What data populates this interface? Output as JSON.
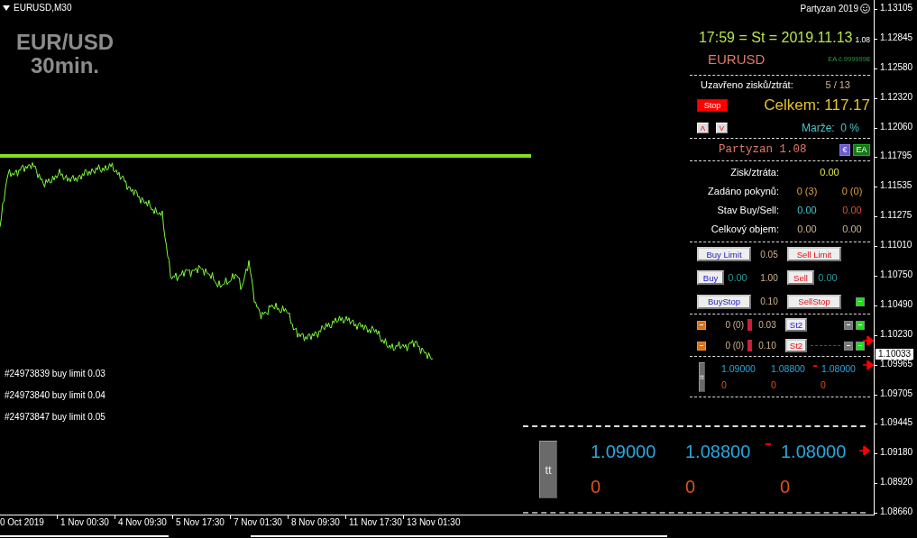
{
  "chart": {
    "title": "EURUSD,M30",
    "watermark": [
      "EUR/USD",
      "30min."
    ],
    "orders": [
      "#24973839 buy limit 0.03",
      "#24973840 buy limit 0.04",
      "#24973847 buy limit 0.05"
    ]
  },
  "price_axis": {
    "labels": [
      "1.13105",
      "1.12845",
      "1.12580",
      "1.12320",
      "1.12060",
      "1.11795",
      "1.11535",
      "1.11275",
      "1.11010",
      "1.10750",
      "1.10490",
      "1.10230",
      "1.09965",
      "1.09705",
      "1.09445",
      "1.09180",
      "1.08920",
      "1.08660"
    ],
    "current_price": "1.10033"
  },
  "time_axis": {
    "labels": [
      "0 Oct 2019",
      "1 Nov 00:30",
      "4 Nov 09:30",
      "5 Nov 17:30",
      "7 Nov 01:30",
      "8 Nov 09:30",
      "11 Nov 17:30",
      "13 Nov 01:30"
    ]
  },
  "panel": {
    "brand": "Partyzan 2019",
    "clock": "17:59 = St = 2019.11.13",
    "clock_version": "1.08",
    "symbol": "EURUSD",
    "ea_number": "EA č.9999998",
    "closed_label": "Uzavřeno zisků/ztrát:",
    "closed_value": "5 / 13",
    "stop_button": "Stop",
    "total": "Celkem: 117.17",
    "up_button": "Λ",
    "down_button": "V",
    "margin": "Marže:  0 %",
    "title": "Partyzan 1.08",
    "euro_button": "€",
    "ea_button": "EA",
    "stats": [
      {
        "kind": "profit",
        "label": "Zisk/ztráta:",
        "values": [
          "0.00"
        ]
      },
      {
        "kind": "orders",
        "label": "Zadáno pokynů:",
        "values": [
          "0 (3)",
          "0 (0)"
        ]
      },
      {
        "kind": "position",
        "label": "Stav Buy/Sell:",
        "values": [
          "0.00",
          "0.00"
        ]
      },
      {
        "kind": "volume",
        "label": "Celkový objem:",
        "values": [
          "0.00",
          "0.00"
        ]
      }
    ],
    "order_rows": [
      {
        "buy": "Buy Limit",
        "lot": "0.05",
        "sell": "Sell Limit"
      },
      {
        "buy": "Buy",
        "buy_value": "0.00",
        "lot": "1.00",
        "sell": "Sell",
        "sell_value": "0.00"
      },
      {
        "buy": "BuyStop",
        "lot": "0.10",
        "sell": "SellStop",
        "switch_on": true
      }
    ],
    "step_rows": [
      {
        "kind": "buy",
        "count": "0 (0)",
        "lot": "0.03",
        "button": "St2",
        "switch_on": true
      },
      {
        "kind": "sell",
        "count": "0 (0)",
        "lot": "0.10",
        "button": "St2",
        "switch_on": true
      }
    ],
    "levels": {
      "toggle": "tt",
      "prices": [
        "1.09000",
        "1.08800",
        "1.08000"
      ],
      "counts": [
        "0",
        "0",
        "0"
      ]
    }
  },
  "zoom_panel": {
    "toggle": "tt",
    "prices": [
      "1.09000",
      "1.08800",
      "1.08000"
    ],
    "counts": [
      "0",
      "0",
      "0"
    ]
  }
}
